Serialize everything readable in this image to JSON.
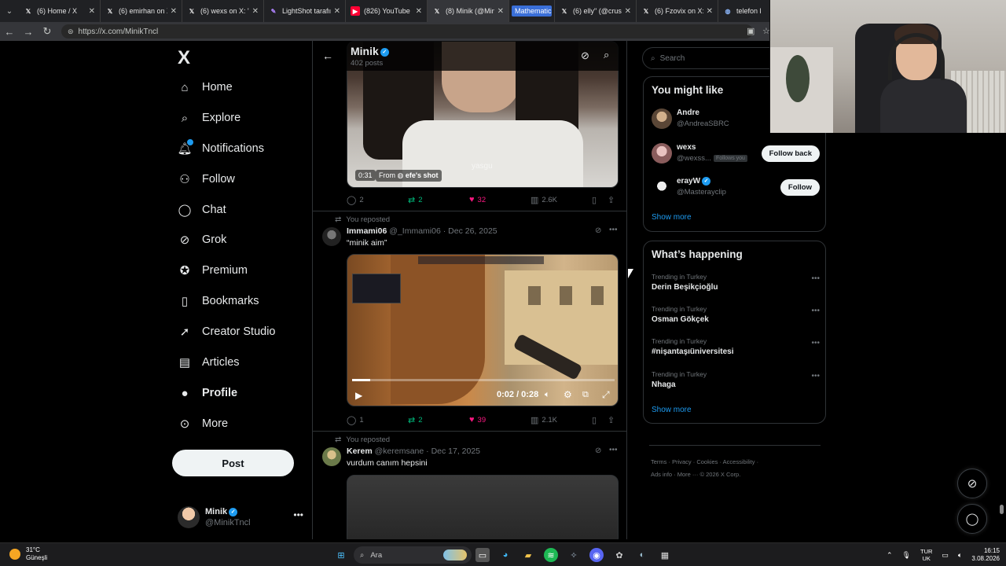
{
  "browser": {
    "tabs": [
      {
        "label": "(6) Home / X",
        "icon": "x-logo-icon"
      },
      {
        "label": "(6) emirhan on X: \"",
        "icon": "x-logo-icon"
      },
      {
        "label": "(6) wexs on X: \"esk",
        "icon": "x-logo-icon"
      },
      {
        "label": "LightShot tarafından",
        "icon": "lightshot-icon"
      },
      {
        "label": "(826) YouTube",
        "icon": "youtube-icon"
      },
      {
        "label": "(8) Minik (@MinikTn",
        "icon": "x-logo-icon"
      },
      {
        "label": "Mathematics",
        "icon": "none"
      },
      {
        "label": "(6) elly\" (@crushca",
        "icon": "x-logo-icon"
      },
      {
        "label": "(6) Fzovix on X: \"E",
        "icon": "x-logo-icon"
      },
      {
        "label": "telefon k",
        "icon": "globe-icon"
      }
    ],
    "url": "https://x.com/MinikTncl"
  },
  "sidebar": {
    "logo": "X",
    "items": [
      {
        "label": "Home",
        "icon": "home-icon"
      },
      {
        "label": "Explore",
        "icon": "search-icon"
      },
      {
        "label": "Notifications",
        "icon": "bell-icon"
      },
      {
        "label": "Follow",
        "icon": "person-add-icon"
      },
      {
        "label": "Chat",
        "icon": "chat-icon"
      },
      {
        "label": "Grok",
        "icon": "grok-icon"
      },
      {
        "label": "Premium",
        "icon": "premium-icon"
      },
      {
        "label": "Bookmarks",
        "icon": "bookmark-icon"
      },
      {
        "label": "Creator Studio",
        "icon": "rocket-icon"
      },
      {
        "label": "Articles",
        "icon": "article-icon"
      },
      {
        "label": "Profile",
        "icon": "profile-icon"
      },
      {
        "label": "More",
        "icon": "more-circle-icon"
      }
    ],
    "post_label": "Post",
    "account": {
      "name": "Minik",
      "handle": "@MinikTncl"
    }
  },
  "header": {
    "name": "Minik",
    "posts": "402 posts"
  },
  "tweets": [
    {
      "media": {
        "duration": "0:31",
        "from_prefix": "From",
        "from_name": "efe's shot",
        "watermark": "yasgu"
      },
      "actions": {
        "replies": "2",
        "reposts": "2",
        "likes": "32",
        "views": "2.6K"
      }
    },
    {
      "reposted_label": "You reposted",
      "name": "Immami06",
      "handle": "@_Immami06",
      "date": "Dec 26, 2025",
      "text": "“minik aim”",
      "video": {
        "time": "0:02 / 0:28",
        "progress": 0.07
      },
      "actions": {
        "replies": "1",
        "reposts": "2",
        "likes": "39",
        "views": "2.1K"
      }
    },
    {
      "reposted_label": "You reposted",
      "name": "Kerem",
      "handle": "@keremsane",
      "date": "Dec 17, 2025",
      "text": "vurdum canım hepsini"
    }
  ],
  "right": {
    "search_placeholder": "Search",
    "who_to_follow": {
      "title": "You might like",
      "users": [
        {
          "name": "Andre",
          "handle": "@AndreaSBRC",
          "button": ""
        },
        {
          "name": "wexs",
          "handle": "@wexss...",
          "badge": "Follows you",
          "button": "Follow back"
        },
        {
          "name": "erayW",
          "handle": "@Masterayclip",
          "button": "Follow"
        }
      ],
      "show_more": "Show more"
    },
    "happening": {
      "title": "What’s happening",
      "trends": [
        {
          "context": "Trending in Turkey",
          "name": "Derin Beşikçioğlu"
        },
        {
          "context": "Trending in Turkey",
          "name": "Osman Gökçek"
        },
        {
          "context": "Trending in Turkey",
          "name": "#nişantaşıüniversitesi"
        },
        {
          "context": "Trending in Turkey",
          "name": "Nhaga"
        }
      ],
      "show_more": "Show more"
    },
    "footer": {
      "line1": "Terms · Privacy · Cookies · Accessibility ·",
      "line2": "Ads info · More ··· © 2026 X Corp."
    }
  },
  "taskbar": {
    "temperature": "31°C",
    "weather": "Güneşli",
    "search": "Ara",
    "lang_top": "TUR",
    "lang_bottom": "UK",
    "time": "16:15",
    "date": "3.08.2026"
  },
  "colors": {
    "accent": "#1d9bf0",
    "repost": "#00ba7c",
    "like": "#f91880",
    "background": "#000000"
  }
}
